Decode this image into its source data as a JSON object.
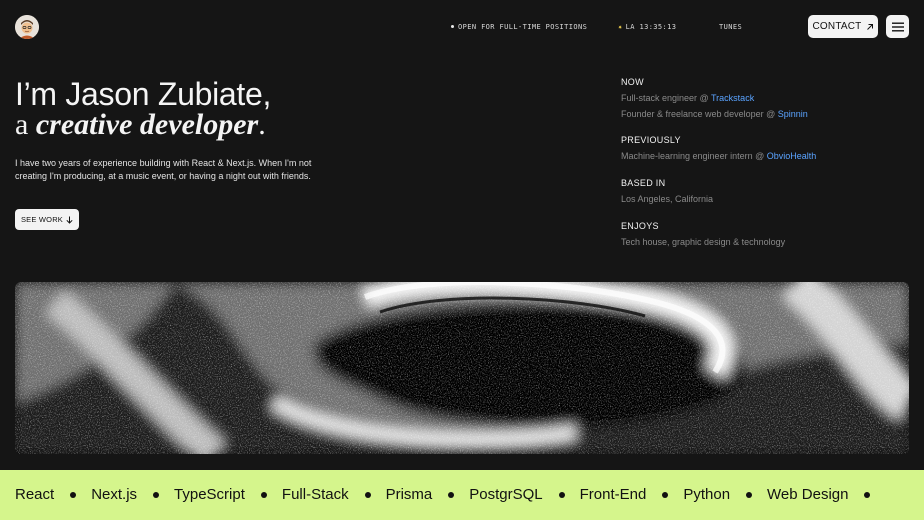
{
  "header": {
    "status_open": "OPEN FOR FULL-TIME POSITIONS",
    "status_time": "LA 13:35:13",
    "tunes_label": "TUNES",
    "contact_label": "CONTACT",
    "avatar_icon": "memoji-avatar-icon",
    "menu_icon": "hamburger-menu-icon"
  },
  "hero": {
    "line1": "I’m Jason Zubiate,",
    "line2_prefix": "a ",
    "line2_emphasis": "creative developer",
    "line2_suffix": ".",
    "bio": "I have two years of experience building with React & Next.js. When I'm not creating I'm producing, at a music event, or having a night out with friends.",
    "see_work_label": "SEE WORK"
  },
  "info": {
    "now": {
      "heading": "NOW",
      "line1_text": "Full-stack engineer @ ",
      "line1_link": "Trackstack",
      "line2_text": "Founder & freelance web developer @ ",
      "line2_link": "Spinnin"
    },
    "previously": {
      "heading": "PREVIOUSLY",
      "line1_text": "Machine-learning engineer intern @ ",
      "line1_link": "ObvioHealth"
    },
    "based_in": {
      "heading": "BASED IN",
      "line1": "Los Angeles, California"
    },
    "enjoys": {
      "heading": "ENJOYS",
      "line1": "Tech house, graphic design & technology"
    }
  },
  "skills": [
    "React",
    "Next.js",
    "TypeScript",
    "Full-Stack",
    "Prisma",
    "PostgrSQL",
    "Front-End",
    "Python",
    "Web Design"
  ],
  "colors": {
    "background": "#151515",
    "accent_link": "#5aa3ff",
    "marquee_bg": "#d5f58c",
    "button_bg": "#f3f3f3"
  }
}
